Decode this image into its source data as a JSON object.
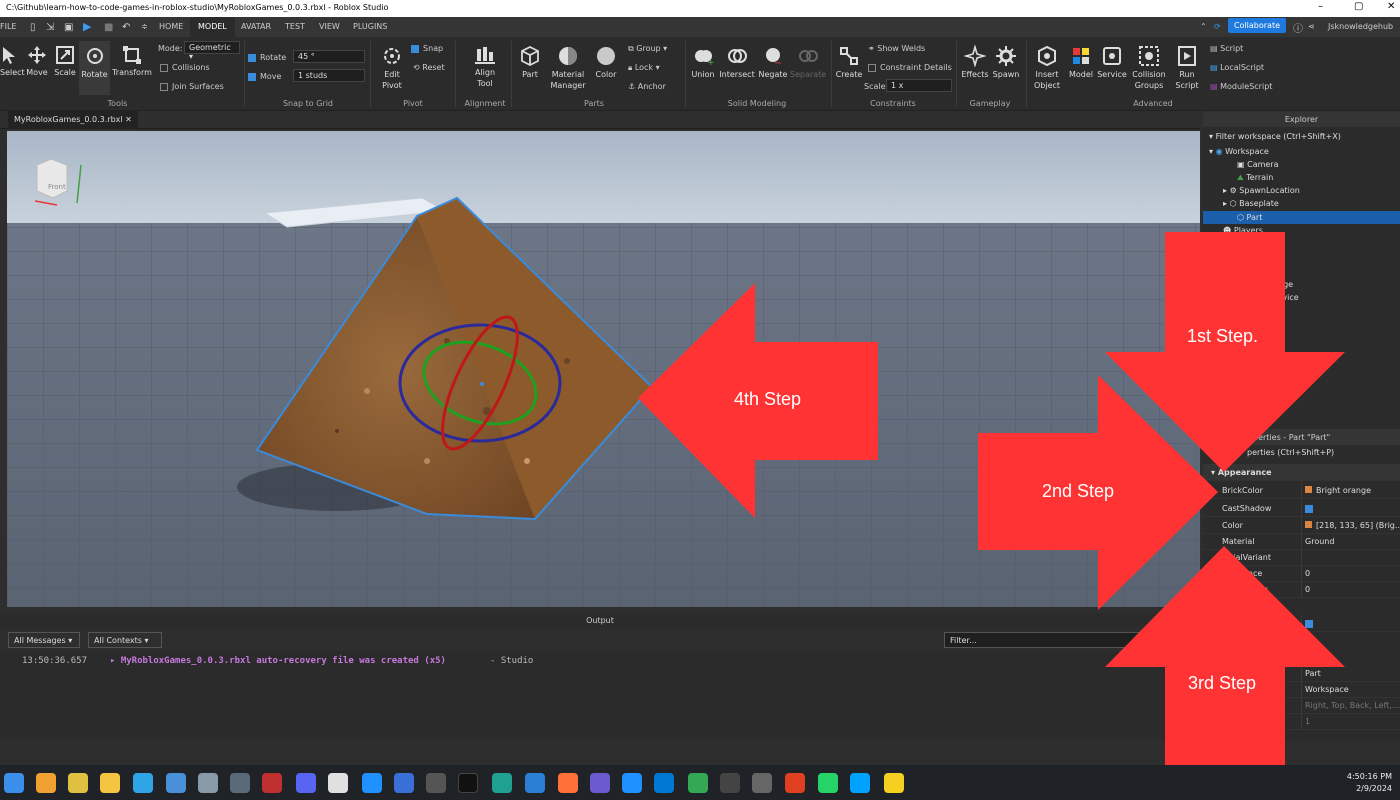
{
  "window": {
    "title": "C:\\Github\\learn-how-to-code-games-in-roblox-studio\\MyRobloxGames_0.0.3.rbxl - Roblox Studio"
  },
  "menu": {
    "file": "FILE",
    "tabs": [
      "HOME",
      "MODEL",
      "AVATAR",
      "TEST",
      "VIEW",
      "PLUGINS"
    ],
    "active_tab": "MODEL",
    "collaborate": "Collaborate",
    "user": "Jsknowledgehub"
  },
  "ribbon": {
    "tools": {
      "buttons": [
        "Select",
        "Move",
        "Scale",
        "Rotate",
        "Transform"
      ],
      "mode_label": "Mode:",
      "mode_value": "Geometric",
      "collisions": "Collisions",
      "join_surfaces": "Join Surfaces",
      "group_label": "Tools"
    },
    "snap": {
      "rotate_label": "Rotate",
      "rotate_value": "45 °",
      "move_label": "Move",
      "move_value": "1 studs",
      "group_label": "Snap to Grid"
    },
    "pivot": {
      "edit_pivot": "Edit Pivot",
      "snap": "Snap",
      "reset": "Reset",
      "group_label": "Pivot"
    },
    "alignment": {
      "align_tool": "Align Tool",
      "group_label": "Alignment"
    },
    "parts": {
      "part": "Part",
      "material_manager": "Material Manager",
      "color": "Color",
      "group": "Group",
      "lock": "Lock",
      "anchor": "Anchor",
      "group_label": "Parts"
    },
    "solid": {
      "buttons": [
        "Union",
        "Intersect",
        "Negate",
        "Separate"
      ],
      "group_label": "Solid Modeling"
    },
    "constraints": {
      "create": "Create",
      "show_welds": "Show Welds",
      "constraint_details": "Constraint Details",
      "scale_label": "Scale",
      "scale_value": "1 x",
      "group_label": "Constraints"
    },
    "gameplay": {
      "buttons": [
        "Effects",
        "Spawn"
      ],
      "group_label": "Gameplay"
    },
    "advanced": {
      "buttons": [
        "Insert Object",
        "Model",
        "Service",
        "Collision Groups",
        "Run Script"
      ],
      "scripts": [
        "Script",
        "LocalScript",
        "ModuleScript"
      ],
      "group_label": "Advanced"
    }
  },
  "doc_tab": "MyRobloxGames_0.0.3.rbxl",
  "viewcube_label": "Front",
  "output": {
    "header": "Output",
    "filter_messages": "All Messages",
    "filter_contexts": "All Contexts",
    "filter_placeholder": "Filter...",
    "log": {
      "timestamp": "13:50:36.657",
      "message": "▸ MyRobloxGames_0.0.3.rbxl auto-recovery file was created (x5)",
      "source": "-  Studio"
    }
  },
  "explorer": {
    "header": "Explorer",
    "filter": "Filter workspace (Ctrl+Shift+X)",
    "items": [
      "Workspace",
      "Camera",
      "Terrain",
      "SpawnLocation",
      "Baseplate",
      "Part",
      "Players"
    ],
    "partial": [
      "ce",
      "rst",
      "orage",
      "service",
      "e"
    ]
  },
  "properties": {
    "header": "perties - Part \"Part\"",
    "filter": "perties (Ctrl+Shift+P)",
    "section": "Appearance",
    "rows": [
      {
        "name": "BrickColor",
        "value": "Bright orange"
      },
      {
        "name": "CastShadow",
        "value": ""
      },
      {
        "name": "Color",
        "value": "[218, 133, 65] (Brig..."
      },
      {
        "name": "Material",
        "value": "Ground"
      },
      {
        "name": "aterialVariant",
        "value": ""
      },
      {
        "name": "ance",
        "value": "0"
      },
      {
        "name": "y",
        "value": "0"
      }
    ],
    "lower_values": [
      "Part",
      "Workspace",
      "Right, Top, Back, Left,...",
      "1"
    ],
    "swatch_color": "#da8541"
  },
  "annotations": {
    "step1": "1st Step.",
    "step2": "2nd Step",
    "step3": "3rd Step",
    "step4": "4th Step",
    "arrow_color": "#ff3333"
  },
  "clock": {
    "time": "4:50:16 PM",
    "date": "2/9/2024"
  }
}
